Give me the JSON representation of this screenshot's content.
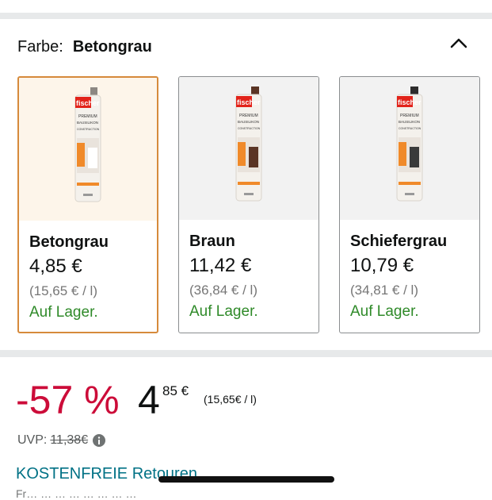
{
  "variation": {
    "label": "Farbe:",
    "selected_value": "Betongrau",
    "options": [
      {
        "name": "Betongrau",
        "price": "4,85 €",
        "unit_price": "(15,65 € / l)",
        "stock": "Auf Lager.",
        "selected": true,
        "nozzle_color": "#8c8782"
      },
      {
        "name": "Braun",
        "price": "11,42 €",
        "unit_price": "(36,84 € / l)",
        "stock": "Auf Lager.",
        "selected": false,
        "nozzle_color": "#5a3424"
      },
      {
        "name": "Schiefergrau",
        "price": "10,79 €",
        "unit_price": "(34,81 € / l)",
        "stock": "Auf Lager.",
        "selected": false,
        "nozzle_color": "#2d2c2c"
      }
    ],
    "product_label": {
      "brand": "fischer",
      "line1": "PREMIUM",
      "line2": "BAUSILIKON",
      "line3": "CONSTRUCTION SILICONE"
    }
  },
  "price_block": {
    "discount": "-57 %",
    "price_whole": "4",
    "price_cents": "85 €",
    "unit_price": "(15,65€ / l)",
    "uvp_label": "UVP:",
    "uvp_value": "11,38€"
  },
  "returns_link": "KOSTENFREIE Retouren",
  "cutoff_text": "Fr… … … … … … … …",
  "colors": {
    "discount_red": "#cc0c39",
    "stock_green": "#2f8a29",
    "selected_border": "#d68a3b",
    "link_teal": "#007185"
  },
  "icons": [
    "chevron-up-icon",
    "info-icon"
  ]
}
